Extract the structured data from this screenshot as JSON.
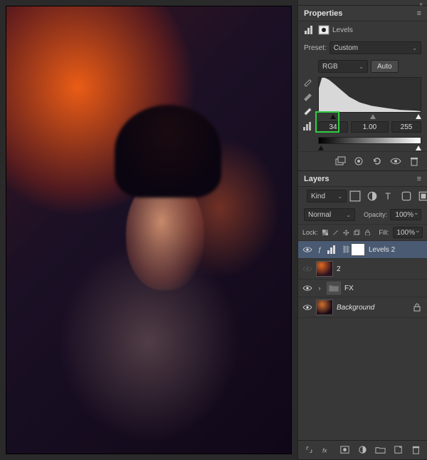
{
  "properties": {
    "panel_title": "Properties",
    "adjustment_name": "Levels",
    "preset_label": "Preset:",
    "preset_value": "Custom",
    "channel": "RGB",
    "auto_label": "Auto",
    "input_black": "34",
    "input_gamma": "1.00",
    "input_white": "255",
    "colors": {
      "highlight": "#2ecc40"
    }
  },
  "layers": {
    "panel_title": "Layers",
    "filter_label": "Kind",
    "blend_mode": "Normal",
    "opacity_label": "Opacity:",
    "opacity_value": "100%",
    "lock_label": "Lock:",
    "fill_label": "Fill:",
    "fill_value": "100%",
    "items": [
      {
        "name": "Levels 2"
      },
      {
        "name": "2"
      },
      {
        "name": "FX"
      },
      {
        "name": "Background"
      }
    ]
  },
  "chart_data": {
    "type": "area",
    "title": "",
    "xlabel": "",
    "ylabel": "",
    "x": [
      0,
      16,
      32,
      48,
      64,
      80,
      96,
      112,
      128,
      144,
      160,
      176,
      192,
      208,
      224,
      240,
      255
    ],
    "values": [
      70,
      100,
      95,
      82,
      58,
      40,
      28,
      20,
      14,
      10,
      8,
      6,
      4,
      3,
      2,
      1,
      1
    ],
    "xlim": [
      0,
      255
    ],
    "ylim": [
      0,
      100
    ],
    "sliders": {
      "black": 34,
      "mid": 1.0,
      "white": 255
    },
    "output_range": [
      0,
      255
    ]
  }
}
